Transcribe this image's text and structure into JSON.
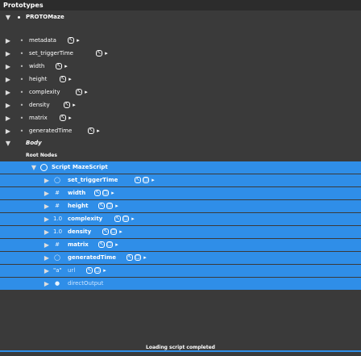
{
  "panel": {
    "title": "Prototypes"
  },
  "proto": {
    "name": "PROTOMaze"
  },
  "fields": [
    {
      "label": "metadata"
    },
    {
      "label": "set_triggerTime"
    },
    {
      "label": "width"
    },
    {
      "label": "height"
    },
    {
      "label": "complexity"
    },
    {
      "label": "density"
    },
    {
      "label": "matrix"
    },
    {
      "label": "generatedTime"
    }
  ],
  "body_label": "Body",
  "root_nodes_label": "Root Nodes",
  "script": {
    "label": "Script MazeScript"
  },
  "script_fields": [
    {
      "label": "set_triggerTime",
      "icon": "◯"
    },
    {
      "label": "width",
      "icon": "#"
    },
    {
      "label": "height",
      "icon": "#"
    },
    {
      "label": "complexity",
      "icon": "1.0"
    },
    {
      "label": "density",
      "icon": "1.0"
    },
    {
      "label": "matrix",
      "icon": "#"
    },
    {
      "label": "generatedTime",
      "icon": "◯"
    },
    {
      "label": "url",
      "icon": "\"a\""
    },
    {
      "label": "directOutput",
      "icon": "●"
    }
  ],
  "status": "Loading script completed",
  "colors": {
    "selection": "#2f8ee8",
    "background": "#3a3a3a",
    "header": "#2c2c2c"
  }
}
